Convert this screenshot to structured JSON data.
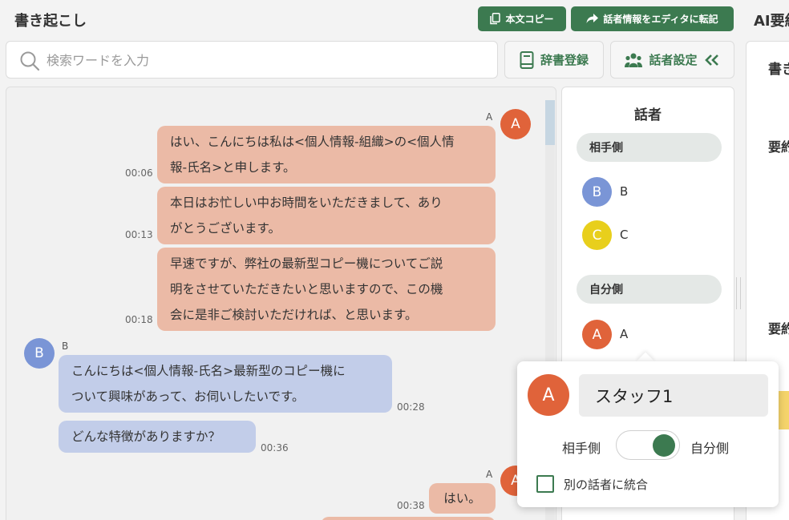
{
  "header": {
    "title": "書き起こし",
    "copy_label": "本文コピー",
    "transfer_label": "話者情報をエディタに転記",
    "ai_title": "AI要約"
  },
  "search": {
    "placeholder": "検索ワードを入力",
    "value": ""
  },
  "toolbar": {
    "dictionary_label": "辞書登録",
    "speaker_settings_label": "話者設定"
  },
  "colors": {
    "accent": "#3c7a50",
    "speaker_a": "#e0633a",
    "speaker_b": "#7a95d6",
    "speaker_c": "#e8cf1c",
    "bubble_a": "#ebbaa6",
    "bubble_b": "#c2cde9"
  },
  "messages": [
    {
      "speaker": "A",
      "lines": [
        "はい、こんにちは私は<個人情報-組織>の<個人情",
        "報-氏名>と申します。"
      ],
      "time": "00:06"
    },
    {
      "speaker": "A",
      "lines": [
        "本日はお忙しい中お時間をいただきまして、あり",
        "がとうございます。"
      ],
      "time": "00:13"
    },
    {
      "speaker": "A",
      "lines": [
        "早速ですが、弊社の最新型コピー機についてご説",
        "明をさせていただきたいと思いますので、この機",
        "会に是非ご検討いただければ、と思います。"
      ],
      "time": "00:18"
    },
    {
      "speaker": "B",
      "lines": [
        "こんにちは<個人情報-氏名>最新型のコピー機に",
        "ついて興味があって、お伺いしたいです。"
      ],
      "time": "00:28"
    },
    {
      "speaker": "B",
      "lines": [
        "どんな特徴がありますか？"
      ],
      "time": "00:36"
    },
    {
      "speaker": "A",
      "lines": [
        "はい。"
      ],
      "time": "00:38"
    }
  ],
  "speaker_panel": {
    "title": "話者",
    "other_group_label": "相手側",
    "self_group_label": "自分側",
    "other_speakers": [
      {
        "id": "B",
        "name": "B"
      },
      {
        "id": "C",
        "name": "C"
      }
    ],
    "self_speakers": [
      {
        "id": "A",
        "name": "A"
      }
    ]
  },
  "ai_panel": {
    "line1": "書き",
    "line2": "要約",
    "line3": "要約"
  },
  "popup": {
    "avatar": "A",
    "name_value": "スタッフ1",
    "toggle_left_label": "相手側",
    "toggle_right_label": "自分側",
    "toggle_state": "自分側",
    "merge_label": "別の話者に統合",
    "merge_checked": false
  }
}
